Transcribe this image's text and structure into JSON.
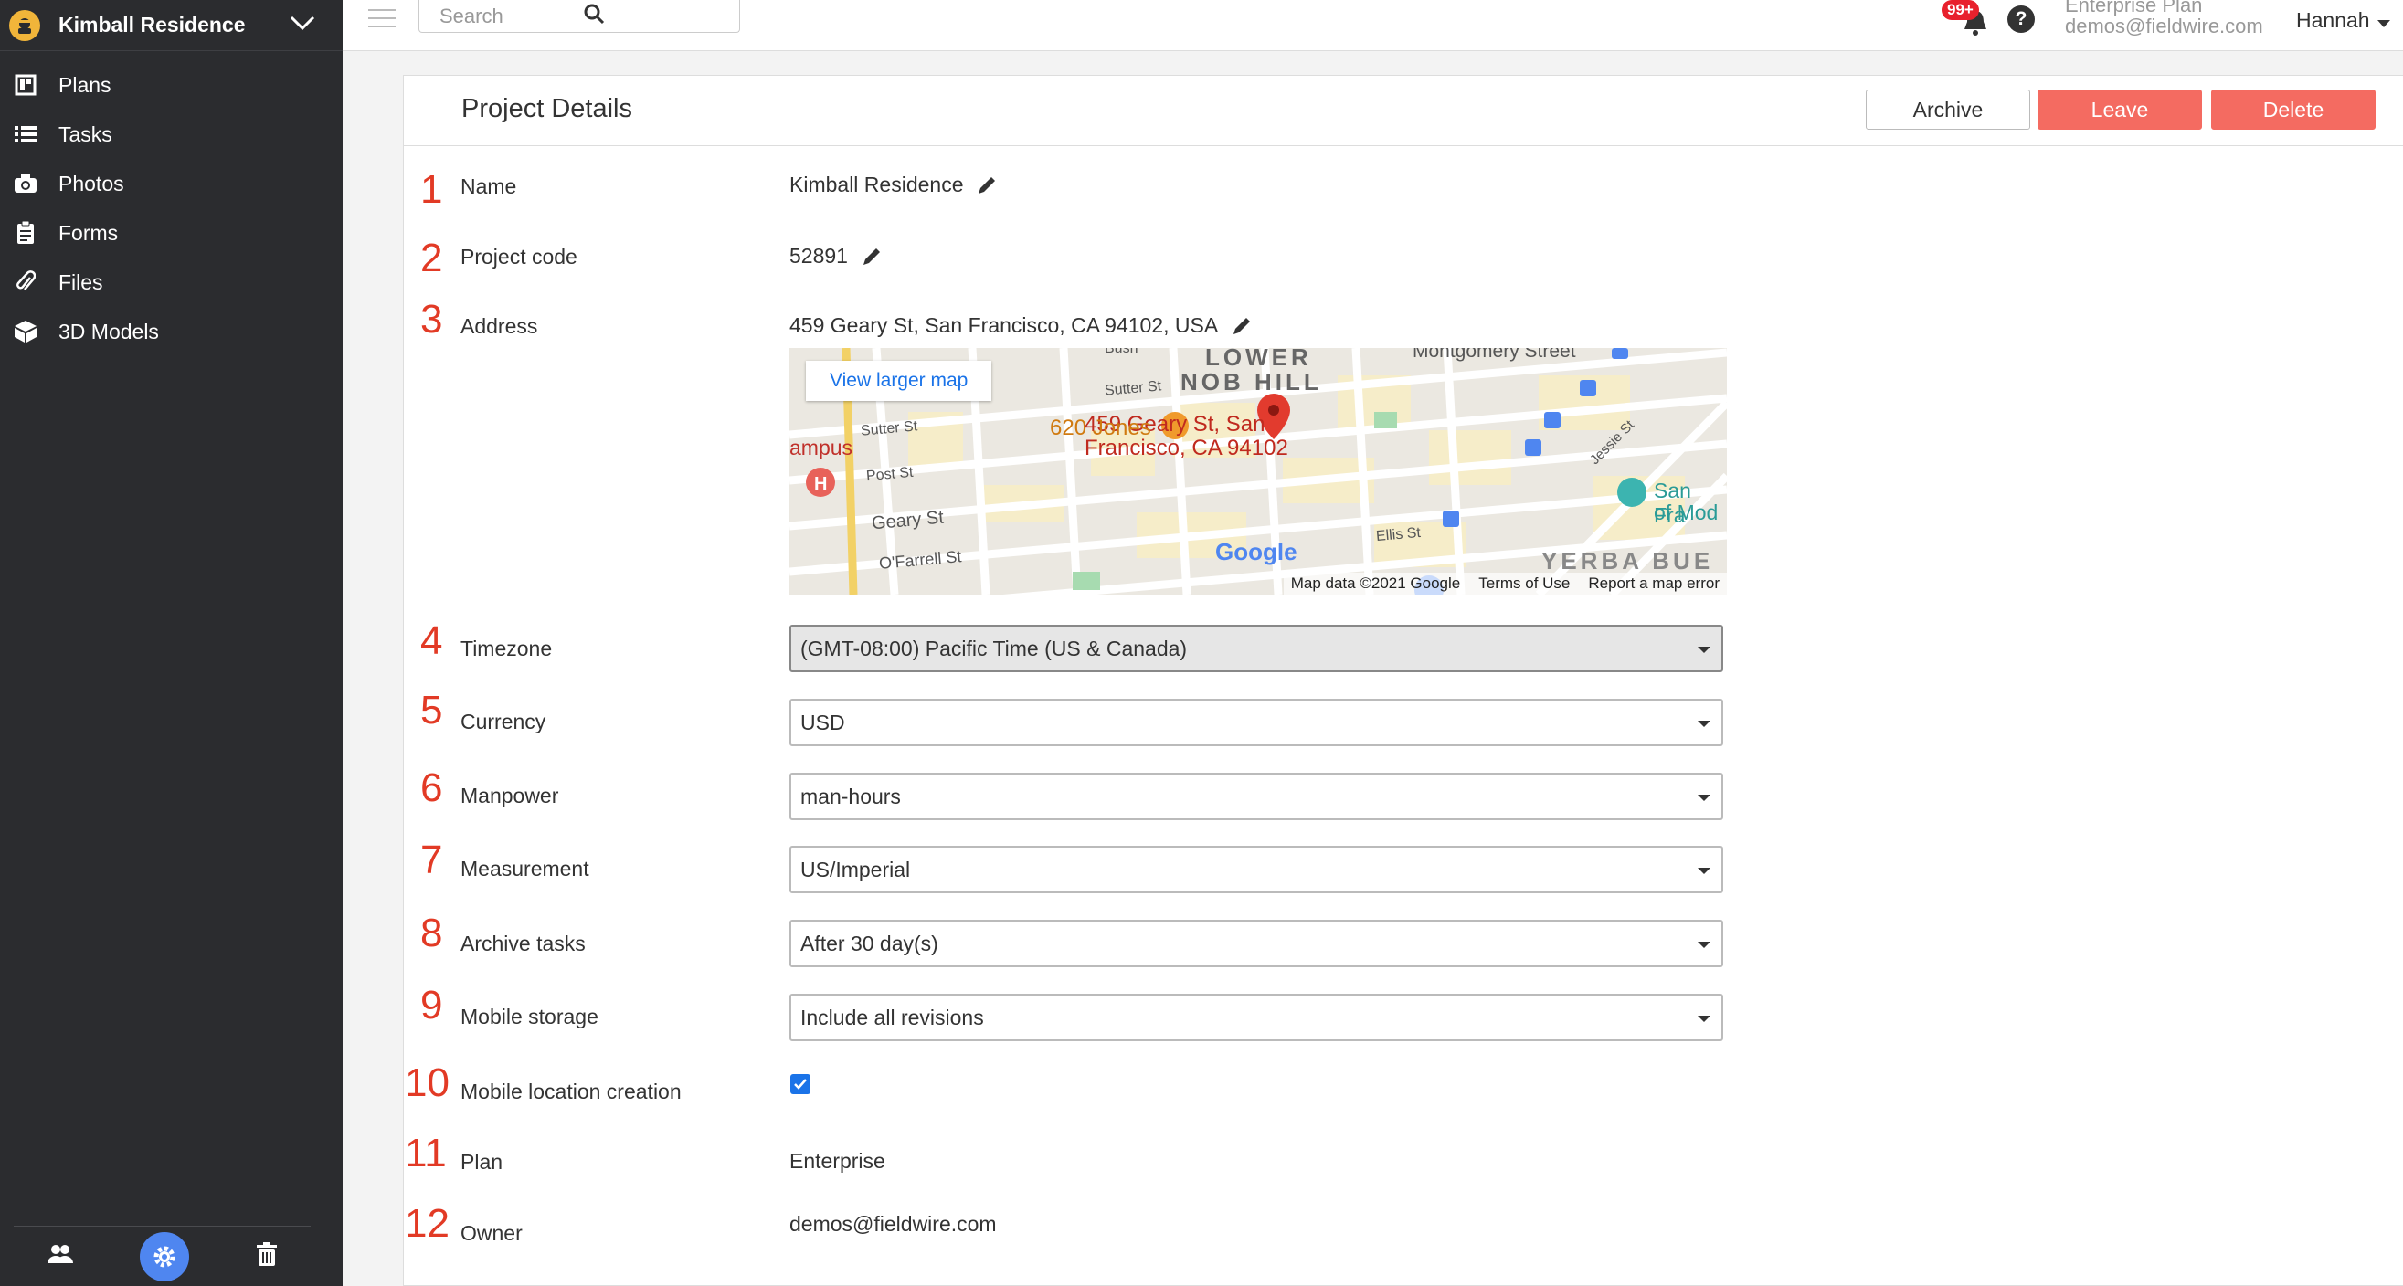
{
  "sidebar": {
    "project_name": "Kimball Residence",
    "items": [
      {
        "label": "Plans",
        "icon": "plans-icon"
      },
      {
        "label": "Tasks",
        "icon": "list-icon"
      },
      {
        "label": "Photos",
        "icon": "camera-icon"
      },
      {
        "label": "Forms",
        "icon": "clipboard-icon"
      },
      {
        "label": "Files",
        "icon": "paperclip-icon"
      },
      {
        "label": "3D Models",
        "icon": "cube-icon"
      }
    ],
    "footer_icons": [
      "people-icon",
      "gear-icon",
      "trash-icon"
    ]
  },
  "topbar": {
    "search_placeholder": "Search",
    "notification_badge": "99+",
    "plan_name": "Enterprise Plan",
    "account_email": "demos@fieldwire.com",
    "user_name": "Hannah"
  },
  "panel": {
    "title": "Project Details",
    "buttons": {
      "archive": "Archive",
      "leave": "Leave",
      "delete": "Delete"
    },
    "rows": [
      {
        "num": "1",
        "label": "Name",
        "value": "Kimball Residence"
      },
      {
        "num": "2",
        "label": "Project code",
        "value": "52891"
      },
      {
        "num": "3",
        "label": "Address",
        "value": "459 Geary St, San Francisco, CA 94102, USA"
      },
      {
        "num": "4",
        "label": "Timezone",
        "value": "(GMT-08:00) Pacific Time (US & Canada)"
      },
      {
        "num": "5",
        "label": "Currency",
        "value": "USD"
      },
      {
        "num": "6",
        "label": "Manpower",
        "value": "man-hours"
      },
      {
        "num": "7",
        "label": "Measurement",
        "value": "US/Imperial"
      },
      {
        "num": "8",
        "label": "Archive tasks",
        "value": "After 30 day(s)"
      },
      {
        "num": "9",
        "label": "Mobile storage",
        "value": "Include all revisions"
      },
      {
        "num": "10",
        "label": "Mobile location creation",
        "value": ""
      },
      {
        "num": "11",
        "label": "Plan",
        "value": "Enterprise"
      },
      {
        "num": "12",
        "label": "Owner",
        "value": "demos@fieldwire.com"
      }
    ],
    "mobile_location_checked": true
  },
  "map": {
    "view_larger": "View larger map",
    "pin_label_line1": "459 Geary St, San",
    "pin_label_line2": "Francisco, CA 94102",
    "poi_620": "620 Jones",
    "district_1": "LOWER",
    "district_2": "NOB HILL",
    "district_3": "YERBA BUE",
    "street_montgomery": "Montgomery Street",
    "street_sutter": "Sutter St",
    "street_sutter2": "Sutter St",
    "street_post": "Post St",
    "street_geary": "Geary St",
    "street_ofarrell": "O'Farrell St",
    "street_ellis": "Ellis St",
    "street_bush": "Bush",
    "street_jessie": "Jessie St",
    "campus": "ampus",
    "sf_moma_1": "San Fra",
    "sf_moma_2": "of Mod",
    "google": "Google",
    "map_data": "Map data ©2021 Google",
    "terms": "Terms of Use",
    "report": "Report a map error"
  }
}
